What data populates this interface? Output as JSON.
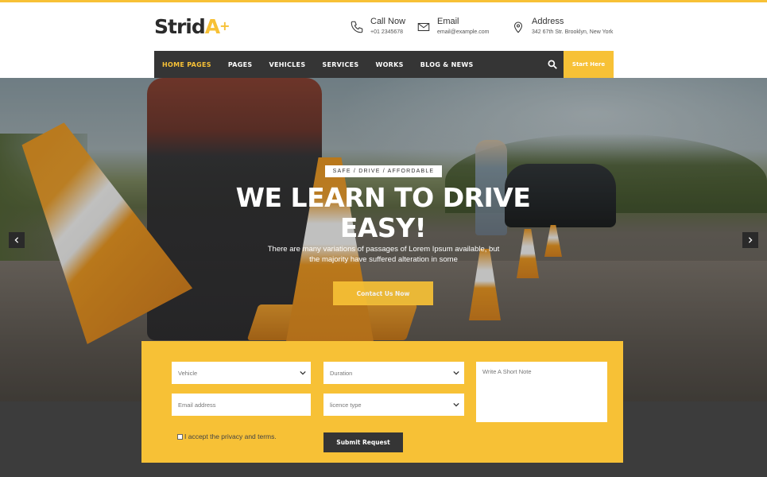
{
  "brand": {
    "name_main": "Strid",
    "name_accent": "A",
    "name_plus": "+"
  },
  "contacts": [
    {
      "title": "Call Now",
      "detail": "+01 2345678",
      "icon": "phone-icon"
    },
    {
      "title": "Email",
      "detail": "email@example.com",
      "icon": "mail-icon"
    },
    {
      "title": "Address",
      "detail": "342 67th Str. Brooklyn, New York",
      "icon": "location-pin-icon"
    }
  ],
  "nav": {
    "items": [
      "HOME PAGES",
      "PAGES",
      "VEHICLES",
      "SERVICES",
      "WORKS",
      "BLOG & NEWS"
    ],
    "active_index": 0,
    "cta": "Start Here",
    "search_icon": "search-icon"
  },
  "hero": {
    "tagline": "SAFE / DRIVE / AFFORDABLE",
    "title_line1": "WE LEARN TO DRIVE",
    "title_line2": "EASY!",
    "desc_line1": "There are many variations of passages of Lorem Ipsum available, but",
    "desc_line2": "the majority have suffered alteration in some",
    "button": "Contact Us Now",
    "prev_icon": "chevron-left-icon",
    "next_icon": "chevron-right-icon"
  },
  "form": {
    "vehicle": "Vehicle",
    "duration": "Duration",
    "email": "Email address",
    "licence": "licence type",
    "note": "Write A Short Note",
    "agree": "I accept the privacy and terms.",
    "submit": "Submit Request"
  },
  "colors": {
    "accent": "#f7c136",
    "dark": "#353535",
    "band": "#3c3c3c"
  }
}
